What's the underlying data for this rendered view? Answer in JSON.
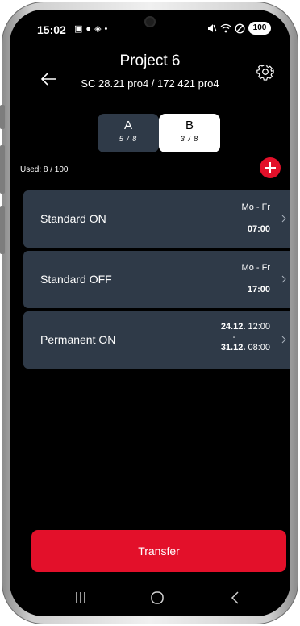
{
  "status_bar": {
    "time": "15:02",
    "left_icons": [
      "screenshot-icon",
      "app-icon",
      "location-icon",
      "dot-icon"
    ],
    "right_icons": [
      "mute-icon",
      "wifi-icon",
      "dnd-icon"
    ],
    "battery": "100"
  },
  "header": {
    "title": "Project 6",
    "subtitle": "SC 28.21 pro4 / 172 421 pro4"
  },
  "tabs": [
    {
      "label": "A",
      "count": "5 / 8",
      "selected": false
    },
    {
      "label": "B",
      "count": "3 / 8",
      "selected": true
    }
  ],
  "used": "Used:  8 / 100",
  "programs": [
    {
      "name": "Standard ON",
      "days": "Mo - Fr",
      "time": "07:00"
    },
    {
      "name": "Standard OFF",
      "days": "Mo - Fr",
      "time": "17:00"
    },
    {
      "name": "Permanent ON",
      "start_date": "24.12.",
      "start_time": "12:00",
      "separator": "-",
      "end_date": "31.12.",
      "end_time": "08:00"
    }
  ],
  "transfer_label": "Transfer",
  "colors": {
    "accent": "#e3102a",
    "card": "#2f3a48",
    "background": "#000000"
  }
}
